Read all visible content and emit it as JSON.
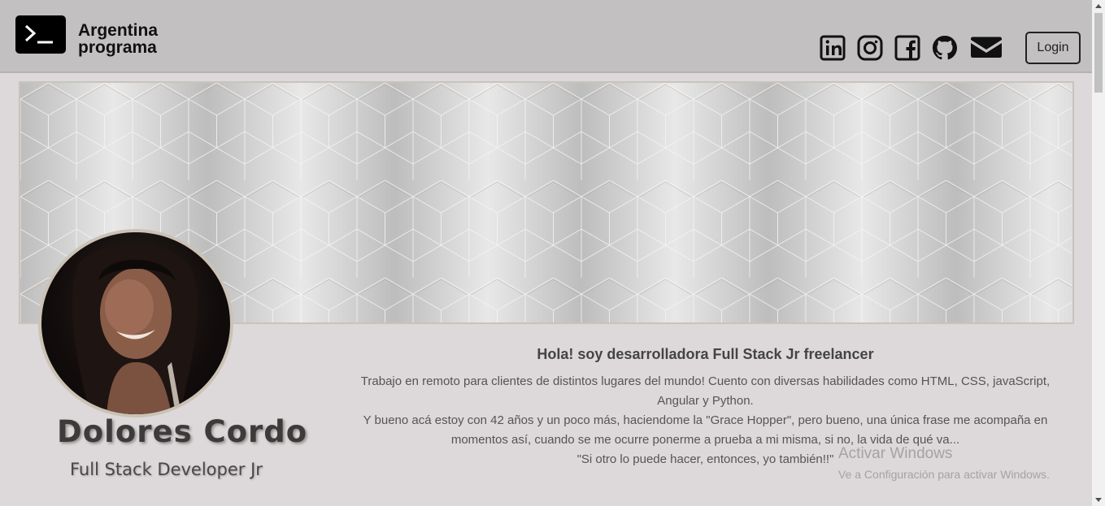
{
  "header": {
    "logo_line1": "Argentina",
    "logo_line2": "programa",
    "login_label": "Login",
    "social_icons": [
      "linkedin-icon",
      "instagram-icon",
      "facebook-icon",
      "github-icon",
      "email-icon"
    ]
  },
  "profile": {
    "name": "Dolores Cordo",
    "role": "Full Stack Developer Jr"
  },
  "about": {
    "title": "Hola! soy desarrolladora Full Stack Jr freelancer",
    "paragraph1": "Trabajo en remoto para clientes de distintos lugares del mundo! Cuento con diversas habilidades como HTML, CSS, javaScript, Angular y Python.",
    "paragraph2": "Y bueno acá estoy con 42 años y un poco más, haciendome la \"Grace Hopper\", pero bueno, una única frase me acompaña en momentos así, cuando se me ocurre ponerme a prueba a mi misma, si no, la vida de qué va...",
    "quote": "\"Si otro lo puede hacer, entonces, yo también!!\""
  },
  "watermark": {
    "line1": "Activar Windows",
    "line2": "Ve a Configuración para activar Windows."
  },
  "colors": {
    "header_bg": "#c2c0c1",
    "page_bg": "#ddd8d9",
    "banner_base": "#c8c8c8"
  }
}
